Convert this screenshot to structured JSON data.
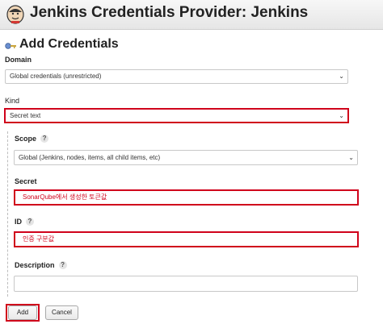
{
  "header": {
    "title": "Jenkins Credentials Provider: Jenkins",
    "logo_icon": "jenkins-logo-icon"
  },
  "form": {
    "heading": "Add Credentials",
    "heading_icon": "key-icon",
    "domain": {
      "label": "Domain",
      "value": "Global credentials (unrestricted)"
    },
    "kind": {
      "label": "Kind",
      "value": "Secret text"
    },
    "scope": {
      "label": "Scope",
      "help": "?",
      "value": "Global (Jenkins, nodes, items, all child items, etc)"
    },
    "secret": {
      "label": "Secret",
      "value": "SonarQube에서 생성한 토큰값"
    },
    "id": {
      "label": "ID",
      "help": "?",
      "value": "인증 구분값"
    },
    "description": {
      "label": "Description",
      "help": "?",
      "value": ""
    },
    "buttons": {
      "add": "Add",
      "cancel": "Cancel"
    }
  },
  "colors": {
    "highlight": "#d0021b",
    "titlebar": "#ececec"
  }
}
